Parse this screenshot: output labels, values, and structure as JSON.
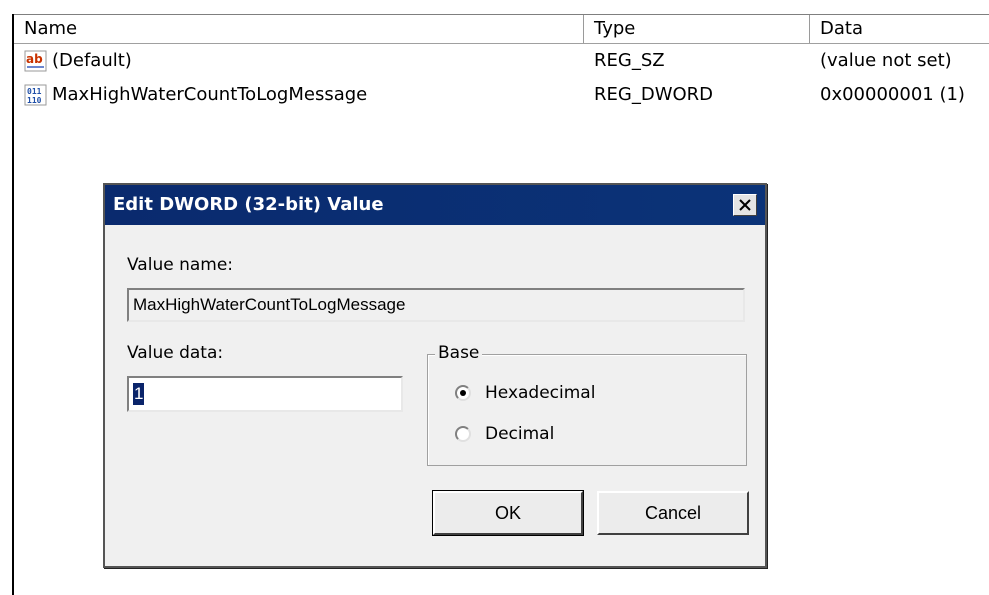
{
  "list": {
    "columns": {
      "name": "Name",
      "type": "Type",
      "data": "Data"
    },
    "rows": [
      {
        "icon": "string-value-icon",
        "name": "(Default)",
        "type": "REG_SZ",
        "data": "(value not set)"
      },
      {
        "icon": "binary-value-icon",
        "name": "MaxHighWaterCountToLogMessage",
        "type": "REG_DWORD",
        "data": "0x00000001 (1)"
      }
    ]
  },
  "dialog": {
    "title": "Edit DWORD (32-bit) Value",
    "close_glyph": "✕",
    "value_name_label": "Value name:",
    "value_name": "MaxHighWaterCountToLogMessage",
    "value_data_label": "Value data:",
    "value_data": "1",
    "base_label": "Base",
    "base_options": [
      {
        "label": "Hexadecimal",
        "checked": true
      },
      {
        "label": "Decimal",
        "checked": false
      }
    ],
    "ok_label": "OK",
    "cancel_label": "Cancel"
  },
  "colors": {
    "titlebar": "#0a2a6e",
    "selection": "#0a246a",
    "dialog_bg": "#f0f0f0"
  }
}
